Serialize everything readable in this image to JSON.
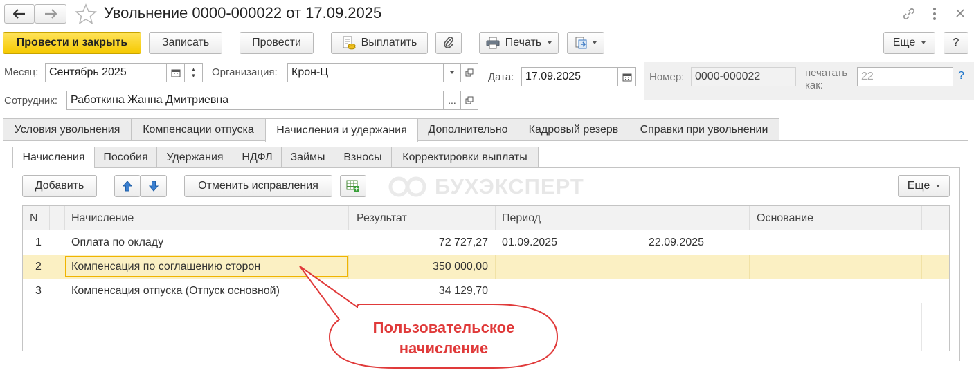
{
  "window": {
    "title": "Увольнение 0000-000022 от 17.09.2025"
  },
  "toolbar": {
    "post_close": "Провести и закрыть",
    "save": "Записать",
    "post": "Провести",
    "pay": "Выплатить",
    "print": "Печать",
    "more": "Еще",
    "help": "?"
  },
  "form": {
    "month_label": "Месяц:",
    "month_value": "Сентябрь 2025",
    "org_label": "Организация:",
    "org_value": "Крон-Ц",
    "date_label": "Дата:",
    "date_value": "17.09.2025",
    "number_label": "Номер:",
    "number_value": "0000-000022",
    "print_as_label_1": "печатать",
    "print_as_label_2": "как:",
    "print_as_value": "22",
    "help_mark": "?",
    "employee_label": "Сотрудник:",
    "employee_value": "Работкина Жанна Дмитриевна",
    "ellipsis": "..."
  },
  "tabs": [
    {
      "label": "Условия увольнения"
    },
    {
      "label": "Компенсации отпуска"
    },
    {
      "label": "Начисления и удержания"
    },
    {
      "label": "Дополнительно"
    },
    {
      "label": "Кадровый резерв"
    },
    {
      "label": "Справки при увольнении"
    }
  ],
  "active_tab": "Начисления и удержания",
  "subtabs": [
    {
      "label": "Начисления"
    },
    {
      "label": "Пособия"
    },
    {
      "label": "Удержания"
    },
    {
      "label": "НДФЛ"
    },
    {
      "label": "Займы"
    },
    {
      "label": "Взносы"
    },
    {
      "label": "Корректировки выплаты"
    }
  ],
  "active_subtab": "Начисления",
  "table_toolbar": {
    "add": "Добавить",
    "cancel_corrections": "Отменить исправления",
    "more": "Еще"
  },
  "watermark": "БУХЭКСПЕРТ",
  "table": {
    "columns": [
      "N",
      "Начисление",
      "Результат",
      "Период",
      "",
      "Основание"
    ],
    "rows": [
      {
        "n": "1",
        "accrual": "Оплата по окладу",
        "result": "72 727,27",
        "period_from": "01.09.2025",
        "period_to": "22.09.2025",
        "basis": ""
      },
      {
        "n": "2",
        "accrual": "Компенсация по соглашению сторон",
        "result": "350 000,00",
        "period_from": "",
        "period_to": "",
        "basis": ""
      },
      {
        "n": "3",
        "accrual": "Компенсация отпуска (Отпуск основной)",
        "result": "34 129,70",
        "period_from": "",
        "period_to": "",
        "basis": ""
      }
    ],
    "selected_row": 2
  },
  "callout": {
    "line1": "Пользовательское",
    "line2": "начисление"
  },
  "colors": {
    "primary_button": "#f5c900",
    "selected_row": "#fbf0c3",
    "selected_cell_border": "#f0b400",
    "callout": "#e03a3a",
    "link_blue": "#1a73c9"
  }
}
